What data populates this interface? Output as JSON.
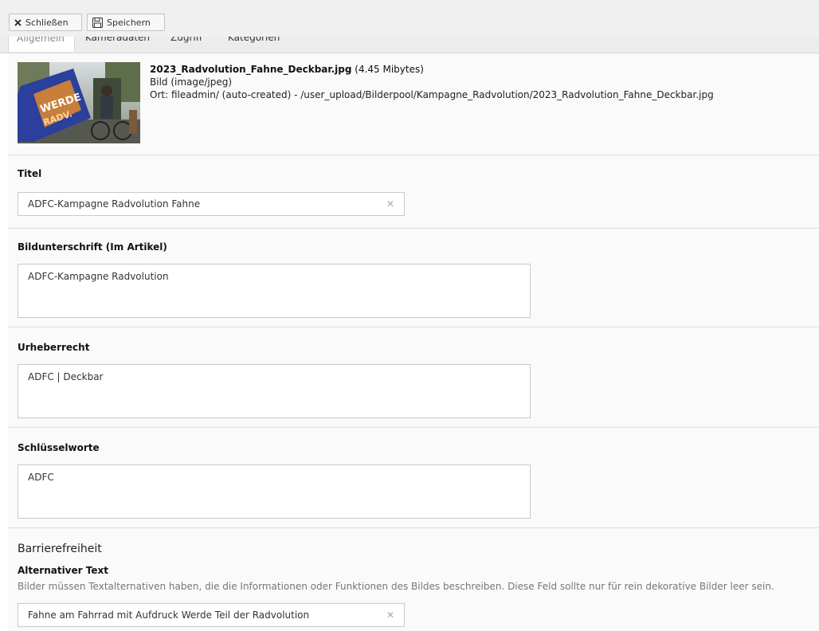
{
  "toolbar": {
    "close_label": "Schließen",
    "save_label": "Speichern"
  },
  "tabs": [
    {
      "label": "Allgemein",
      "active": true
    },
    {
      "label": "Kameradaten",
      "active": false
    },
    {
      "label": "Zugriff",
      "active": false
    },
    {
      "label": "Kategorien",
      "active": false
    }
  ],
  "file": {
    "name": "2023_Radvolution_Fahne_Deckbar.jpg",
    "size": "(4.45 Mibytes)",
    "type": "Bild (image/jpeg)",
    "location": "Ort: fileadmin/ (auto-created) - /user_upload/Bilderpool/Kampagne_Radvolution/2023_Radvolution_Fahne_Deckbar.jpg"
  },
  "fields": {
    "title": {
      "label": "Titel",
      "value": "ADFC-Kampagne Radvolution Fahne"
    },
    "caption": {
      "label": "Bildunterschrift (Im Artikel)",
      "value": "ADFC-Kampagne Radvolution"
    },
    "copyright": {
      "label": "Urheberrecht",
      "value": "ADFC | Deckbar"
    },
    "keywords": {
      "label": "Schlüsselworte",
      "value": "ADFC"
    }
  },
  "accessibility": {
    "group_title": "Barrierefreiheit",
    "alt_label": "Alternativer Text",
    "alt_description": "Bilder müssen Textalternativen haben, die die Informationen oder Funktionen des Bildes beschreiben. Diese Feld sollte nur für rein dekorative Bilder leer sein.",
    "alt_value": "Fahne am Fahrrad mit Aufdruck Werde Teil der Radvolution"
  },
  "icons": {
    "close": "close-icon",
    "save": "save-icon",
    "clear": "clear-icon"
  },
  "colors": {
    "toolbar_bg": "#f0f0f0",
    "section_bg": "#fafafa",
    "input_border": "#c9c9c9"
  }
}
